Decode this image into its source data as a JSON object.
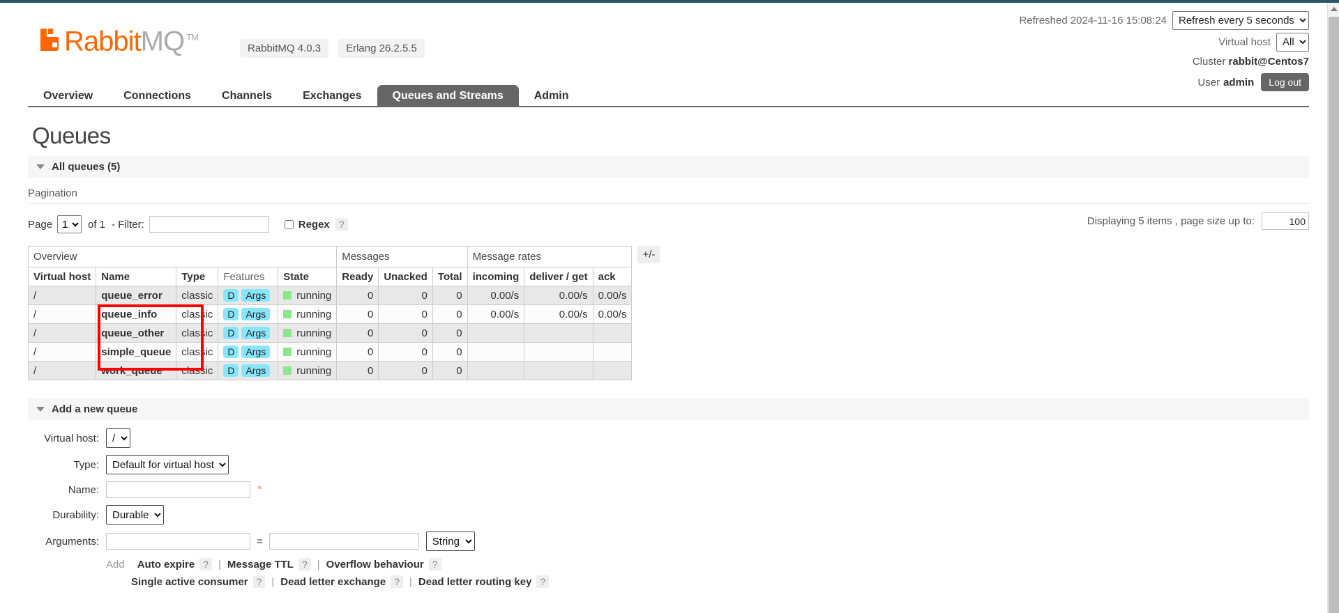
{
  "brand": {
    "name_primary": "Rabbit",
    "name_secondary": "MQ",
    "trademark": "TM",
    "version_pill": "RabbitMQ 4.0.3",
    "erlang_pill": "Erlang 26.2.5.5"
  },
  "header": {
    "refreshed_label": "Refreshed 2024-11-16 15:08:24",
    "refresh_select": "Refresh every 5 seconds",
    "vhost_label": "Virtual host",
    "vhost_select": "All",
    "cluster_label": "Cluster",
    "cluster_name": "rabbit@Centos7",
    "user_label": "User",
    "user_name": "admin",
    "logout_label": "Log out"
  },
  "nav": {
    "tabs": [
      {
        "label": "Overview",
        "active": false
      },
      {
        "label": "Connections",
        "active": false
      },
      {
        "label": "Channels",
        "active": false
      },
      {
        "label": "Exchanges",
        "active": false
      },
      {
        "label": "Queues and Streams",
        "active": true
      },
      {
        "label": "Admin",
        "active": false
      }
    ]
  },
  "page": {
    "title": "Queues",
    "all_queues_header": "All queues (5)",
    "add_queue_header": "Add a new queue"
  },
  "pagination": {
    "title": "Pagination",
    "page_label": "Page",
    "page_value": "1",
    "of_label": "of 1",
    "filter_label": "- Filter:",
    "filter_value": "",
    "regex_label": "Regex",
    "help": "?",
    "displaying": "Displaying 5 items , page size up to:",
    "page_size": "100"
  },
  "table": {
    "group_headers": [
      {
        "label": "Overview",
        "span": 5
      },
      {
        "label": "Messages",
        "span": 3
      },
      {
        "label": "Message rates",
        "span": 3
      }
    ],
    "columns": [
      "Virtual host",
      "Name",
      "Type",
      "Features",
      "State",
      "Ready",
      "Unacked",
      "Total",
      "incoming",
      "deliver / get",
      "ack"
    ],
    "plus_minus": "+/-",
    "badge_durable": "D",
    "badge_args": "Args",
    "rows": [
      {
        "vhost": "/",
        "name": "queue_error",
        "type": "classic",
        "features": [
          "D",
          "Args"
        ],
        "state": "running",
        "ready": "0",
        "unacked": "0",
        "total": "0",
        "incoming": "0.00/s",
        "deliver_get": "0.00/s",
        "ack": "0.00/s"
      },
      {
        "vhost": "/",
        "name": "queue_info",
        "type": "classic",
        "features": [
          "D",
          "Args"
        ],
        "state": "running",
        "ready": "0",
        "unacked": "0",
        "total": "0",
        "incoming": "0.00/s",
        "deliver_get": "0.00/s",
        "ack": "0.00/s"
      },
      {
        "vhost": "/",
        "name": "queue_other",
        "type": "classic",
        "features": [
          "D",
          "Args"
        ],
        "state": "running",
        "ready": "0",
        "unacked": "0",
        "total": "0",
        "incoming": "",
        "deliver_get": "",
        "ack": ""
      },
      {
        "vhost": "/",
        "name": "simple_queue",
        "type": "classic",
        "features": [
          "D",
          "Args"
        ],
        "state": "running",
        "ready": "0",
        "unacked": "0",
        "total": "0",
        "incoming": "",
        "deliver_get": "",
        "ack": ""
      },
      {
        "vhost": "/",
        "name": "work_queue",
        "type": "classic",
        "features": [
          "D",
          "Args"
        ],
        "state": "running",
        "ready": "0",
        "unacked": "0",
        "total": "0",
        "incoming": "",
        "deliver_get": "",
        "ack": ""
      }
    ]
  },
  "annotation": {
    "color": "#ff0000",
    "note": "red rectangle highlighting queue_error / queue_info / queue_other name cells"
  },
  "add_queue": {
    "vhost_label": "Virtual host:",
    "vhost_value": "/",
    "type_label": "Type:",
    "type_value": "Default for virtual host",
    "name_label": "Name:",
    "name_value": "",
    "name_required": "*",
    "durability_label": "Durability:",
    "durability_value": "Durable",
    "arguments_label": "Arguments:",
    "arg_key": "",
    "arg_value": "",
    "equals": "=",
    "arg_type": "String",
    "add_label": "Add",
    "hints_row1": [
      "Auto expire",
      "Message TTL",
      "Overflow behaviour"
    ],
    "hints_row2": [
      "Single active consumer",
      "Dead letter exchange",
      "Dead letter routing key"
    ],
    "help": "?",
    "separator": "|"
  },
  "colors": {
    "brand_orange": "#ff6600",
    "tab_active_bg": "#666666",
    "badge_cyan": "#88e6fb",
    "state_green": "#89e989",
    "annotation_red": "#ff0000",
    "top_rule": "#2b5566"
  }
}
